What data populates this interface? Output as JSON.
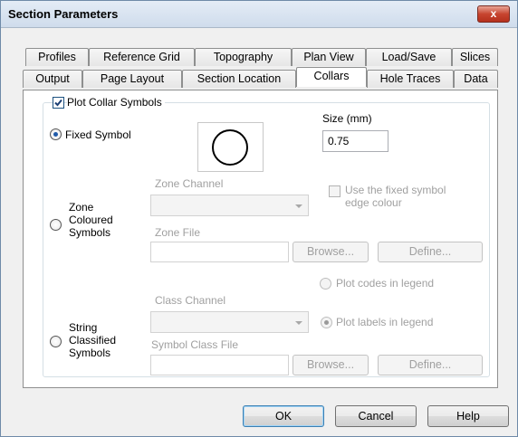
{
  "window": {
    "title": "Section Parameters",
    "close_glyph": "x"
  },
  "tabs": {
    "row_back": [
      "Profiles",
      "Reference Grid",
      "Topography",
      "Plan View",
      "Load/Save",
      "Slices"
    ],
    "row_front": [
      "Output",
      "Page Layout",
      "Section Location",
      "Collars",
      "Hole Traces",
      "Data"
    ],
    "selected": "Collars"
  },
  "collars": {
    "plot_collar_symbols": {
      "label": "Plot Collar Symbols",
      "checked": true
    },
    "fixed_symbol": {
      "label": "Fixed Symbol",
      "selected": true,
      "symbol_icon": "circle-symbol-icon"
    },
    "size": {
      "label": "Size (mm)",
      "value": "0.75"
    },
    "zone": {
      "radio_line1": "Zone",
      "radio_line2": "Coloured",
      "radio_line3": "Symbols",
      "channel_label": "Zone Channel",
      "use_fixed_edge_line1": "Use the fixed symbol",
      "use_fixed_edge_line2": "edge colour",
      "file_label": "Zone File",
      "browse": "Browse...",
      "define": "Define..."
    },
    "string": {
      "radio_line1": "String",
      "radio_line2": "Classified",
      "radio_line3": "Symbols",
      "plot_codes": "Plot codes in legend",
      "class_channel_label": "Class Channel",
      "plot_labels": "Plot labels in legend",
      "file_label": "Symbol Class File",
      "browse": "Browse...",
      "define": "Define..."
    }
  },
  "footer": {
    "ok": "OK",
    "cancel": "Cancel",
    "help": "Help"
  }
}
